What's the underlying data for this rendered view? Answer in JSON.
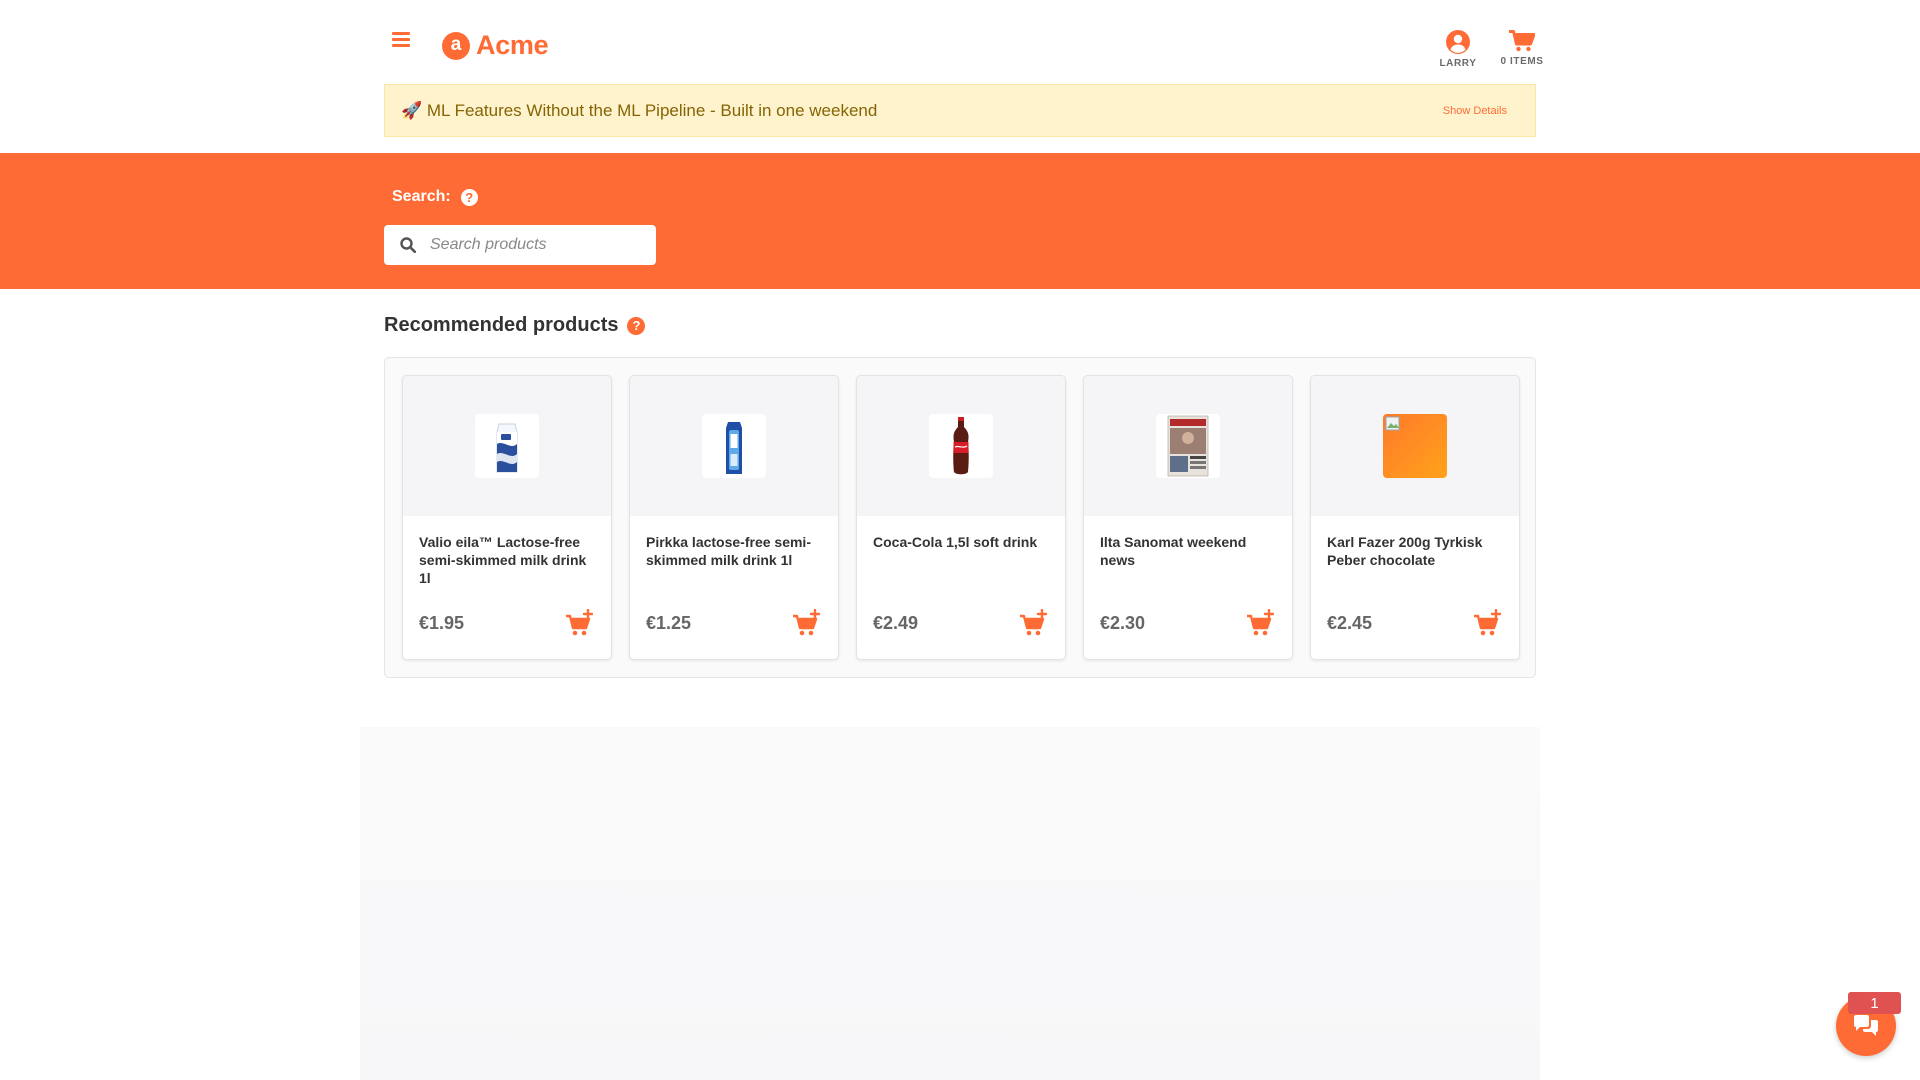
{
  "brand": {
    "logo_letter": "a",
    "name": "Acme"
  },
  "header": {
    "user_label": "LARRY",
    "cart_label": "0 ITEMS"
  },
  "banner": {
    "text": "🚀 ML Features Without the ML Pipeline - Built in one weekend",
    "link": "Show Details"
  },
  "search": {
    "label": "Search:",
    "help_glyph": "?",
    "placeholder": "Search products"
  },
  "recommended": {
    "title": "Recommended products",
    "help_glyph": "?",
    "products": [
      {
        "name": "Valio eila™ Lactose-free semi-skimmed milk drink 1l",
        "price": "€1.95"
      },
      {
        "name": "Pirkka lactose-free semi-skimmed milk drink 1l",
        "price": "€1.25"
      },
      {
        "name": "Coca-Cola 1,5l soft drink",
        "price": "€2.49"
      },
      {
        "name": "Ilta Sanomat weekend news",
        "price": "€2.30"
      },
      {
        "name": "Karl Fazer 200g Tyrkisk Peber chocolate",
        "price": "€2.45"
      }
    ]
  },
  "chat": {
    "badge": "1"
  },
  "colors": {
    "accent": "#ff6b35",
    "banner_bg": "#fff3cd",
    "banner_text": "#856404",
    "badge": "#e05252"
  },
  "icons": {
    "menu": "hamburger-icon",
    "user": "user-circle-icon",
    "cart": "shopping-cart-icon",
    "search": "search-icon",
    "help": "question-circle-icon",
    "add_to_cart": "cart-plus-icon",
    "chat": "comments-icon"
  }
}
